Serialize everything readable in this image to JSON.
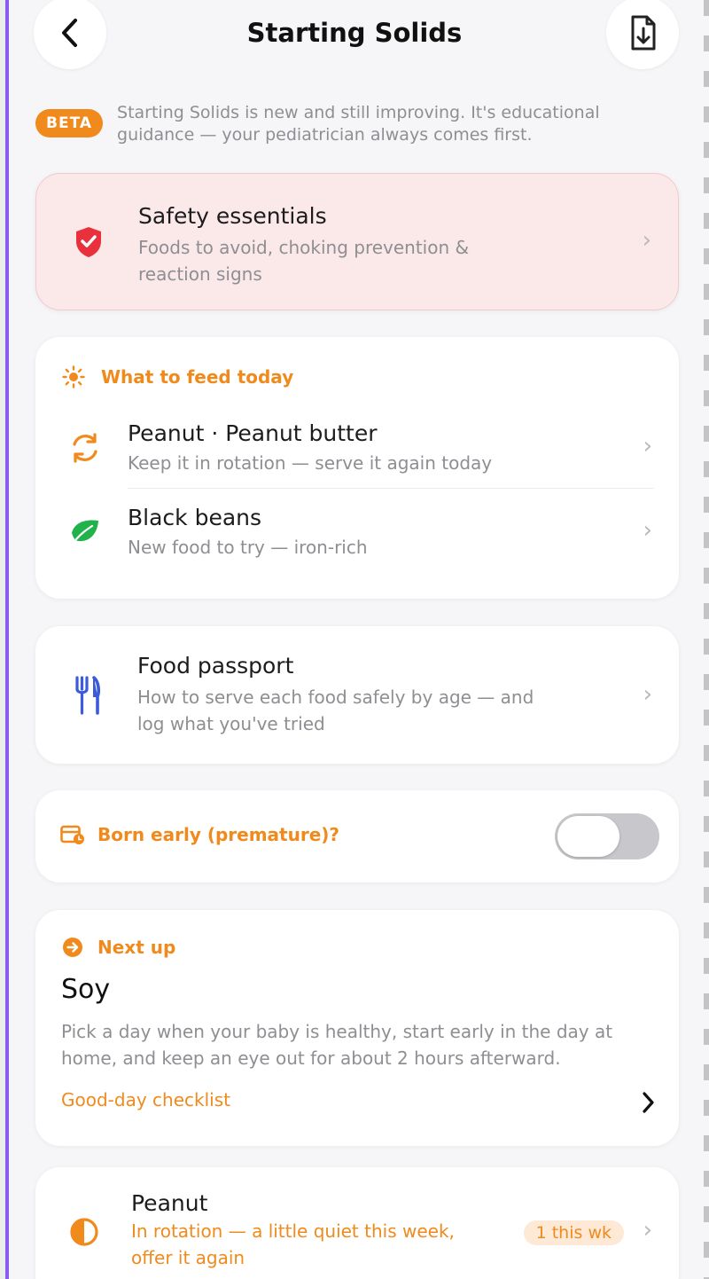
{
  "header": {
    "title": "Starting Solids"
  },
  "beta": {
    "badge": "BETA",
    "line1": "Starting Solids is new and still improving. It's educational",
    "line2": "guidance — your pediatrician always comes first."
  },
  "safety": {
    "title": "Safety essentials",
    "sub1": "Foods to avoid, choking prevention &",
    "sub2": "reaction signs"
  },
  "feed_today": {
    "label": "What to feed today",
    "items": [
      {
        "title": "Peanut · Peanut butter",
        "sub": "Keep it in rotation — serve it again today",
        "icon": "rotate-icon"
      },
      {
        "title": "Black beans",
        "sub": "New food to try — iron-rich",
        "icon": "leaf-icon"
      }
    ]
  },
  "passport": {
    "title": "Food passport",
    "sub1": "How to serve each food safely by age — and",
    "sub2": "log what you've tried"
  },
  "premature": {
    "label": "Born early (premature)?",
    "enabled": false
  },
  "next_up": {
    "label": "Next up",
    "food": "Soy",
    "desc1": "Pick a day when your baby is healthy, start early in the day at",
    "desc2": "home, and keep an eye out for about 2 hours afterward.",
    "link": "Good-day checklist"
  },
  "rotation": {
    "title": "Peanut",
    "sub1": "In rotation — a little quiet this week,",
    "sub2": "offer it again",
    "badge": "1 this wk"
  },
  "colors": {
    "accent": "#f08a1c",
    "danger": "#e8313d",
    "fork": "#3b5bdb",
    "leaf": "#22b24c"
  }
}
